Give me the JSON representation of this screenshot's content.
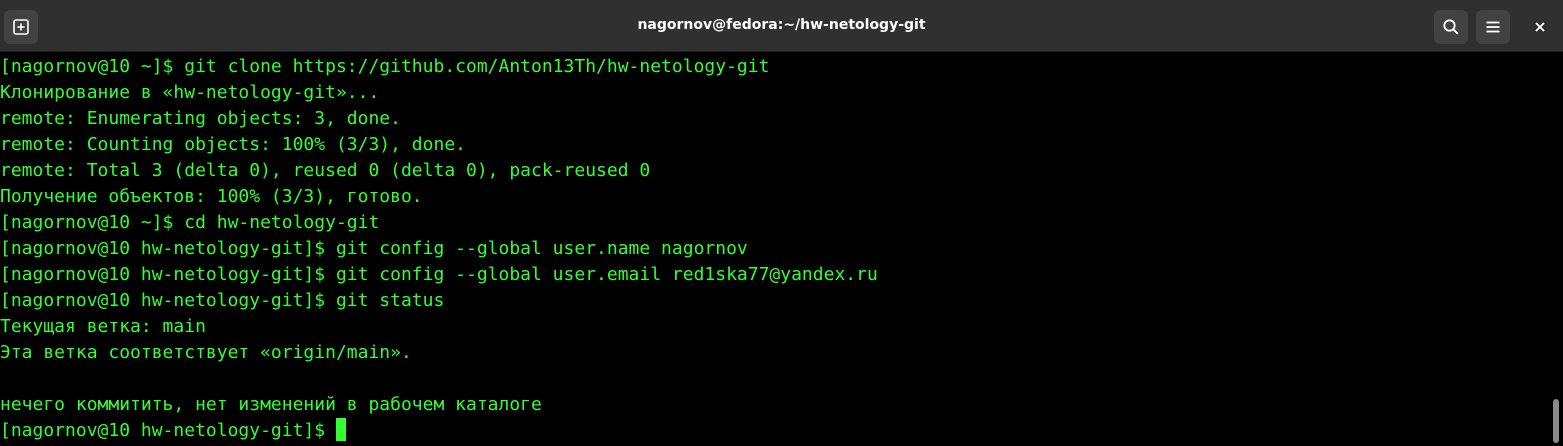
{
  "window": {
    "title": "nagornov@fedora:~/hw-netology-git"
  },
  "colors": {
    "terminal_fg": "#33ff33",
    "terminal_bg": "#000000",
    "titlebar_bg": "#303030"
  },
  "icons": {
    "new_tab": "new-tab-icon",
    "search": "search-icon",
    "menu": "hamburger-menu-icon",
    "close": "close-icon"
  },
  "terminal": {
    "lines": [
      "[nagornov@10 ~]$ git clone https://github.com/Anton13Th/hw-netology-git",
      "Клонирование в «hw-netology-git»...",
      "remote: Enumerating objects: 3, done.",
      "remote: Counting objects: 100% (3/3), done.",
      "remote: Total 3 (delta 0), reused 0 (delta 0), pack-reused 0",
      "Получение объектов: 100% (3/3), готово.",
      "[nagornov@10 ~]$ cd hw-netology-git",
      "[nagornov@10 hw-netology-git]$ git config --global user.name nagornov",
      "[nagornov@10 hw-netology-git]$ git config --global user.email red1ska77@yandex.ru",
      "[nagornov@10 hw-netology-git]$ git status",
      "Текущая ветка: main",
      "Эта ветка соответствует «origin/main».",
      "",
      "нечего коммитить, нет изменений в рабочем каталоге"
    ],
    "prompt": "[nagornov@10 hw-netology-git]$ "
  }
}
